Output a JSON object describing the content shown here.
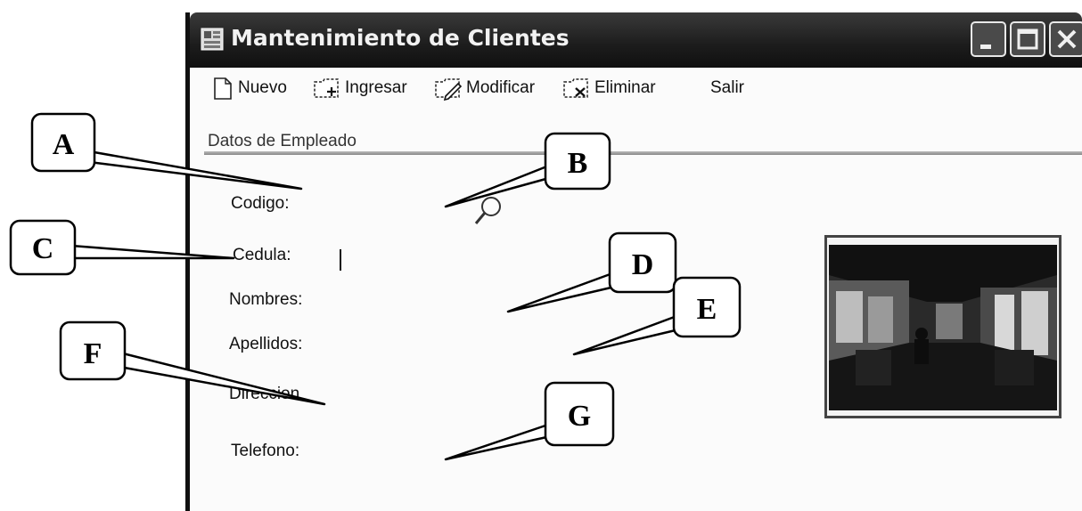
{
  "window": {
    "title": "Mantenimiento de Clientes",
    "icon": "app-form-icon",
    "controls": [
      "minimize-icon",
      "maximize-icon",
      "close-icon"
    ]
  },
  "toolbar": {
    "items": [
      {
        "label": "Nuevo",
        "icon": "new-document-icon"
      },
      {
        "label": "Ingresar",
        "icon": "folder-add-icon"
      },
      {
        "label": "Modificar",
        "icon": "folder-edit-icon"
      },
      {
        "label": "Eliminar",
        "icon": "folder-delete-icon"
      },
      {
        "label": "Salir"
      }
    ]
  },
  "form": {
    "group_title": "Datos de Empleado",
    "fields": {
      "codigo": "Codigo:",
      "cedula": "Cedula:",
      "nombres": "Nombres:",
      "apellidos": "Apellidos:",
      "direccion": "Direccion",
      "telefono": "Telefono:"
    },
    "search_icon": "magnifier-icon",
    "photo": "bus-interior-photo"
  },
  "callouts": {
    "a": "A",
    "b": "B",
    "c": "C",
    "d": "D",
    "e": "E",
    "f": "F",
    "g": "G"
  }
}
